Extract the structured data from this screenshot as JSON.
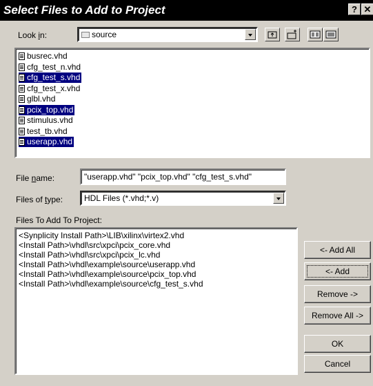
{
  "window": {
    "title": "Select Files to Add to Project",
    "help_glyph": "?",
    "close_glyph": "✕"
  },
  "look_in": {
    "label_prefix": "Look ",
    "label_accel": "i",
    "label_suffix": "n:",
    "value": "source"
  },
  "files": [
    {
      "name": "busrec.vhd",
      "selected": false
    },
    {
      "name": "cfg_test_n.vhd",
      "selected": false
    },
    {
      "name": "cfg_test_s.vhd",
      "selected": true
    },
    {
      "name": "cfg_test_x.vhd",
      "selected": false
    },
    {
      "name": "glbl.vhd",
      "selected": false
    },
    {
      "name": "pcix_top.vhd",
      "selected": true
    },
    {
      "name": "stimulus.vhd",
      "selected": false
    },
    {
      "name": "test_tb.vhd",
      "selected": false
    },
    {
      "name": "userapp.vhd",
      "selected": true
    }
  ],
  "file_name": {
    "label_prefix": "File ",
    "label_accel": "n",
    "label_suffix": "ame:",
    "value": "\"userapp.vhd\" \"pcix_top.vhd\" \"cfg_test_s.vhd\""
  },
  "files_of_type": {
    "label_prefix": "Files of ",
    "label_accel": "t",
    "label_suffix": "ype:",
    "value": "HDL Files (*.vhd;*.v)"
  },
  "files_to_add": {
    "label": "Files To Add To Project:",
    "paths": [
      "<Synplicity Install Path>\\LIB\\xilinx\\virtex2.vhd",
      "<Install Path>\\vhdl\\src\\xpci\\pcix_core.vhd",
      "<Install Path>\\vhdl\\src\\xpci\\pcix_lc.vhd",
      "<Install Path>\\vhdl\\example\\source\\userapp.vhd",
      "<Install Path>\\vhdl\\example\\source\\pcix_top.vhd",
      "<Install Path>\\vhdl\\example\\source\\cfg_test_s.vhd"
    ]
  },
  "buttons": {
    "add_all": "<- Add All",
    "add": "<- Add",
    "remove": "Remove ->",
    "remove_all": "Remove All ->",
    "ok": "OK",
    "cancel": "Cancel"
  }
}
